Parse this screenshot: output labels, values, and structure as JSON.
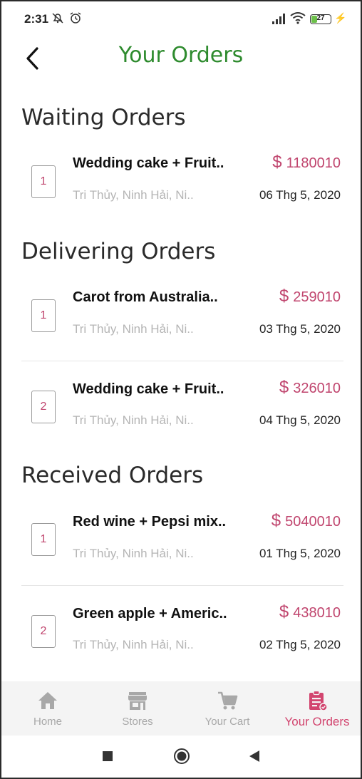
{
  "status_bar": {
    "time": "2:31",
    "battery": "27",
    "battery_level": 0.27,
    "icons": [
      "notifications-off-icon",
      "alarm-icon",
      "signal-icon",
      "wifi-icon",
      "battery-icon",
      "charging-icon"
    ]
  },
  "header": {
    "title": "Your Orders",
    "back_icon": "chevron-left-icon"
  },
  "sections": [
    {
      "title": "Waiting Orders",
      "orders": [
        {
          "index": "1",
          "name": "Wedding cake + Fruit..",
          "price": "1180010",
          "address": "Tri Thủy, Ninh Hải, Ni..",
          "date": "06 Thg 5, 2020"
        }
      ]
    },
    {
      "title": "Delivering Orders",
      "orders": [
        {
          "index": "1",
          "name": "Carot from Australia..",
          "price": "259010",
          "address": "Tri Thủy, Ninh Hải, Ni..",
          "date": "03 Thg 5, 2020"
        },
        {
          "index": "2",
          "name": "Wedding cake + Fruit..",
          "price": "326010",
          "address": "Tri Thủy, Ninh Hải, Ni..",
          "date": "04 Thg 5, 2020"
        }
      ]
    },
    {
      "title": "Received Orders",
      "orders": [
        {
          "index": "1",
          "name": "Red wine + Pepsi mix..",
          "price": "5040010",
          "address": "Tri Thủy, Ninh Hải, Ni..",
          "date": "01 Thg 5, 2020"
        },
        {
          "index": "2",
          "name": "Green apple + Americ..",
          "price": "438010",
          "address": "Tri Thủy, Ninh Hải, Ni..",
          "date": "02 Thg 5, 2020"
        }
      ]
    }
  ],
  "currency_symbol": "$",
  "bottom_nav": [
    {
      "label": "Home",
      "icon": "home-icon",
      "active": false
    },
    {
      "label": "Stores",
      "icon": "store-icon",
      "active": false
    },
    {
      "label": "Your Cart",
      "icon": "cart-icon",
      "active": false
    },
    {
      "label": "Your Orders",
      "icon": "orders-clipboard-icon",
      "active": true
    }
  ],
  "system_nav": [
    "recents-square-icon",
    "home-circle-icon",
    "back-triangle-icon"
  ],
  "colors": {
    "title_green": "#2e8b2e",
    "accent_pink": "#c0456e",
    "active_nav": "#d2456f",
    "inactive_nav": "#a8a8a8",
    "address_gray": "#b5b5b5"
  }
}
